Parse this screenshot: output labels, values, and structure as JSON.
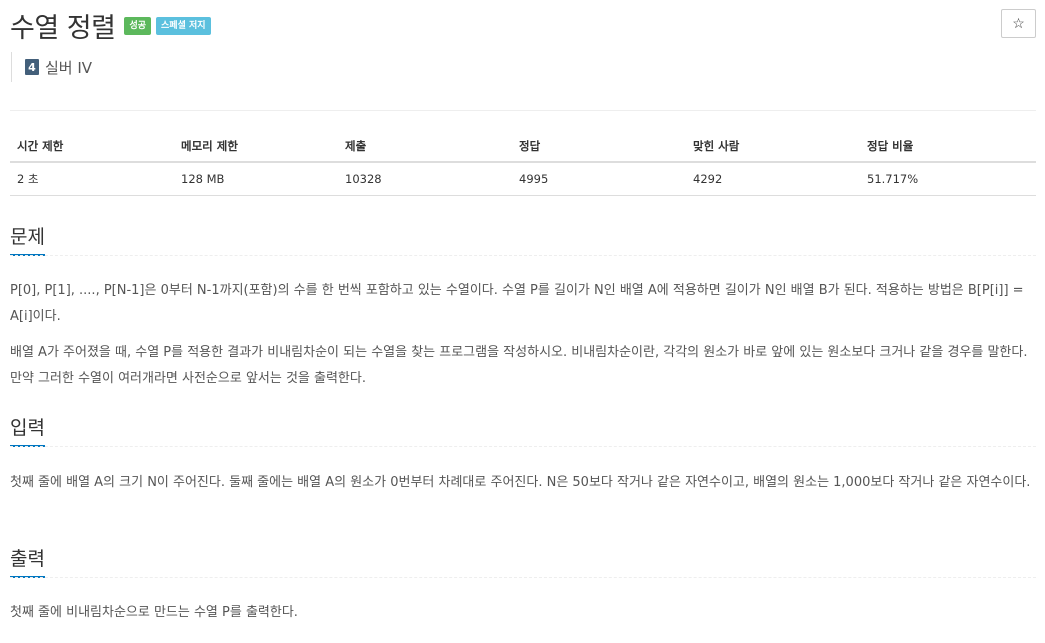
{
  "problem": {
    "title": "수열 정렬",
    "badges": [
      "성공",
      "스페셜 저지"
    ],
    "star": "☆",
    "tier": {
      "number": "4",
      "label": "실버 IV"
    }
  },
  "info_table": {
    "headers": [
      "시간 제한",
      "메모리 제한",
      "제출",
      "정답",
      "맞힌 사람",
      "정답 비율"
    ],
    "values": [
      "2 초",
      "128 MB",
      "10328",
      "4995",
      "4292",
      "51.717%"
    ]
  },
  "sections": {
    "problem": {
      "heading": "문제",
      "paragraphs": [
        "P[0], P[1], ...., P[N-1]은 0부터 N-1까지(포함)의 수를 한 번씩 포함하고 있는 수열이다. 수열 P를 길이가 N인 배열 A에 적용하면 길이가 N인 배열 B가 된다. 적용하는 방법은 B[P[i]] = A[i]이다.",
        "배열 A가 주어졌을 때, 수열 P를 적용한 결과가 비내림차순이 되는 수열을 찾는 프로그램을 작성하시오. 비내림차순이란, 각각의 원소가 바로 앞에 있는 원소보다 크거나 같을 경우를 말한다. 만약 그러한 수열이 여러개라면 사전순으로 앞서는 것을 출력한다."
      ]
    },
    "input": {
      "heading": "입력",
      "paragraphs": [
        "첫째 줄에 배열 A의 크기 N이 주어진다. 둘째 줄에는 배열 A의 원소가 0번부터 차례대로 주어진다. N은 50보다 작거나 같은 자연수이고, 배열의 원소는 1,000보다 작거나 같은 자연수이다."
      ]
    },
    "output": {
      "heading": "출력",
      "paragraphs": [
        "첫째 줄에 비내림차순으로 만드는 수열 P를 출력한다."
      ]
    }
  }
}
